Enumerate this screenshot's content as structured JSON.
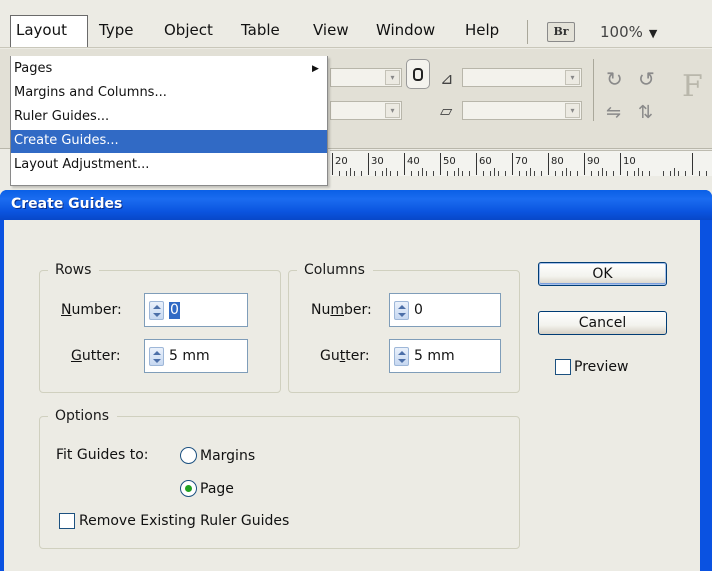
{
  "menubar": {
    "items": [
      "Layout",
      "Type",
      "Object",
      "Table",
      "View",
      "Window",
      "Help"
    ],
    "active": "Layout",
    "bridge_badge": "Br",
    "zoom": "100%"
  },
  "toolbar": {
    "icons": [
      "chain-link-icon",
      "rotate-icon",
      "shear-icon",
      "flip-icon"
    ]
  },
  "ruler": {
    "labels": [
      "20",
      "30",
      "40",
      "50",
      "60",
      "70",
      "80",
      "90",
      "10"
    ]
  },
  "layout_menu": {
    "items": [
      {
        "label": "Pages",
        "submenu": true
      },
      {
        "label": "Margins and Columns..."
      },
      {
        "label": "Ruler Guides..."
      },
      {
        "label": "Create Guides...",
        "highlighted": true
      },
      {
        "label": "Layout Adjustment..."
      }
    ]
  },
  "dialog": {
    "title": "Create Guides",
    "rows": {
      "legend": "Rows",
      "number_label": "Number:",
      "number_value": "0",
      "gutter_label": "Gutter:",
      "gutter_value": "5 mm"
    },
    "columns": {
      "legend": "Columns",
      "number_label": "Number:",
      "number_value": "0",
      "gutter_label": "Gutter:",
      "gutter_value": "5 mm"
    },
    "options": {
      "legend": "Options",
      "fit_label": "Fit Guides to:",
      "margins_label": "Margins",
      "page_label": "Page",
      "fit_selected": "Page",
      "remove_label": "Remove Existing Ruler Guides",
      "remove_checked": false
    },
    "buttons": {
      "ok": "OK",
      "cancel": "Cancel"
    },
    "preview_label": "Preview",
    "preview_checked": false,
    "colors": {
      "titlebar": "#0a52e1",
      "selection": "#316ac5",
      "radio_dot": "#21a121"
    }
  }
}
